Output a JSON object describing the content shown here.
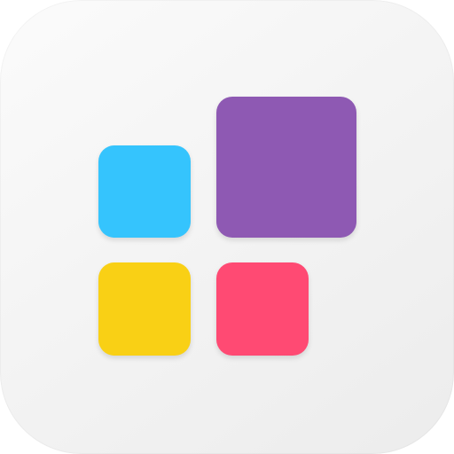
{
  "icon": {
    "name": "widget-grid-app-icon",
    "background_color": "#f4f4f4",
    "tiles": [
      {
        "name": "blue-tile",
        "color": "#35c4fd"
      },
      {
        "name": "purple-tile",
        "color": "#8e59b3"
      },
      {
        "name": "yellow-tile",
        "color": "#f9d015"
      },
      {
        "name": "pink-tile",
        "color": "#ff4a73"
      }
    ]
  }
}
